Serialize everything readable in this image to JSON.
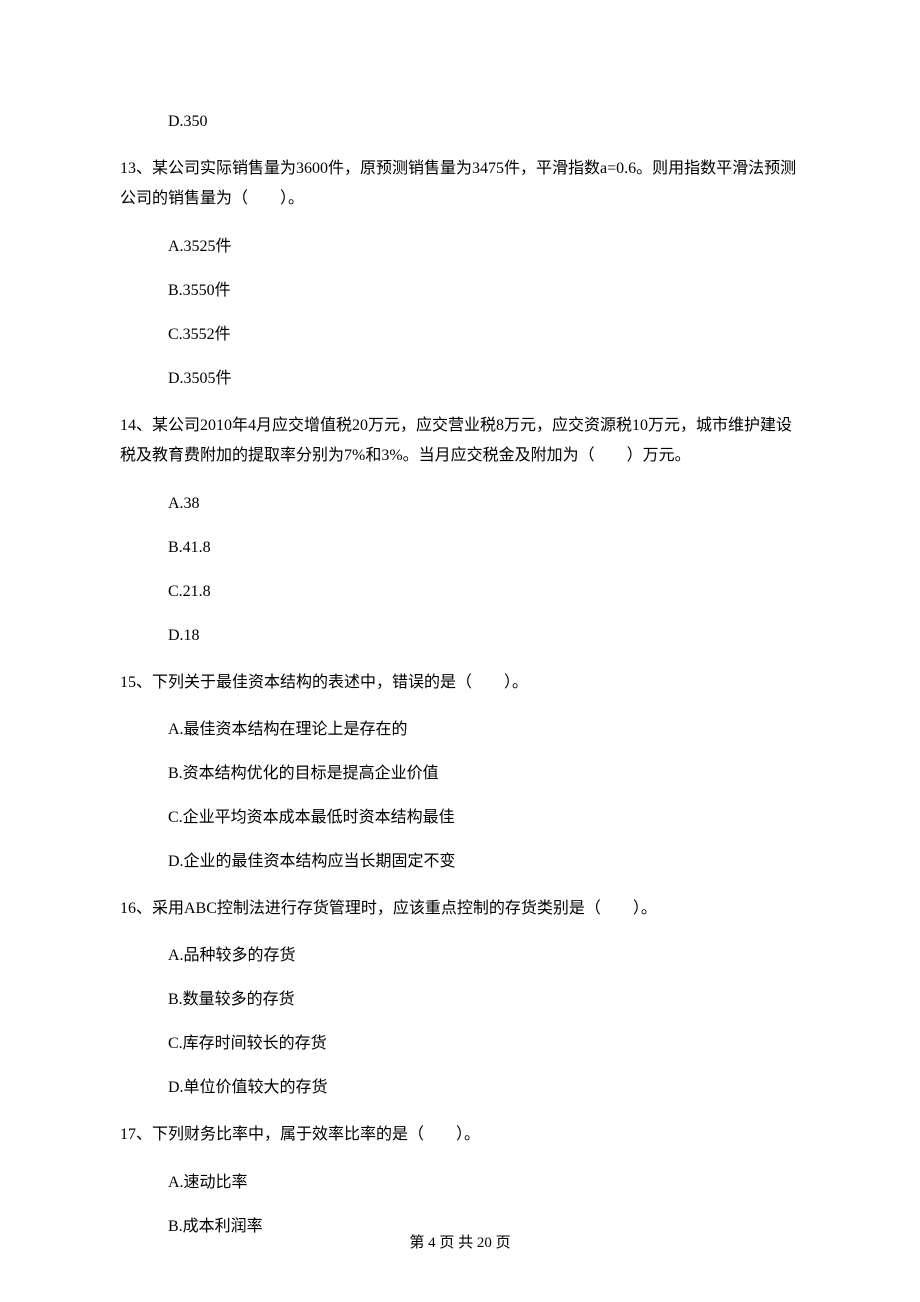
{
  "q12_orphan_option": "D.350",
  "q13": {
    "stem": "13、某公司实际销售量为3600件，原预测销售量为3475件，平滑指数a=0.6。则用指数平滑法预测公司的销售量为（　　）。",
    "options": {
      "a": "A.3525件",
      "b": "B.3550件",
      "c": "C.3552件",
      "d": "D.3505件"
    }
  },
  "q14": {
    "stem": "14、某公司2010年4月应交增值税20万元，应交营业税8万元，应交资源税10万元，城市维护建设税及教育费附加的提取率分别为7%和3%。当月应交税金及附加为（　　）万元。",
    "options": {
      "a": "A.38",
      "b": "B.41.8",
      "c": "C.21.8",
      "d": "D.18"
    }
  },
  "q15": {
    "stem": "15、下列关于最佳资本结构的表述中，错误的是（　　）。",
    "options": {
      "a": "A.最佳资本结构在理论上是存在的",
      "b": "B.资本结构优化的目标是提高企业价值",
      "c": "C.企业平均资本成本最低时资本结构最佳",
      "d": "D.企业的最佳资本结构应当长期固定不变"
    }
  },
  "q16": {
    "stem": "16、采用ABC控制法进行存货管理时，应该重点控制的存货类别是（　　）。",
    "options": {
      "a": "A.品种较多的存货",
      "b": "B.数量较多的存货",
      "c": "C.库存时间较长的存货",
      "d": "D.单位价值较大的存货"
    }
  },
  "q17": {
    "stem": "17、下列财务比率中，属于效率比率的是（　　）。",
    "options": {
      "a": "A.速动比率",
      "b": "B.成本利润率"
    }
  },
  "footer": "第 4 页 共 20 页"
}
